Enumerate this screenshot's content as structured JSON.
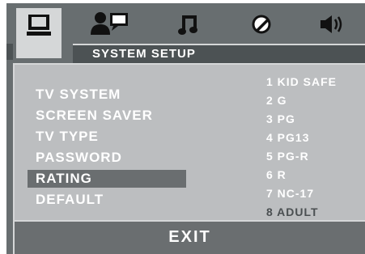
{
  "tabs": [
    {
      "icon": "monitor-icon",
      "active": true
    },
    {
      "icon": "user-speech-icon",
      "active": false
    },
    {
      "icon": "music-note-icon",
      "active": false
    },
    {
      "icon": "circle-slash-icon",
      "active": false
    },
    {
      "icon": "speaker-icon",
      "active": false
    }
  ],
  "title": "SYSTEM SETUP",
  "menu": {
    "items": [
      "TV SYSTEM",
      "SCREEN SAVER",
      "TV TYPE",
      "PASSWORD",
      "RATING",
      "DEFAULT"
    ],
    "selected_index": 4
  },
  "rating_options": {
    "items": [
      "1 KID SAFE",
      "2 G",
      "3 PG",
      "4 PG13",
      "5 PG-R",
      "6 R",
      "7 NC-17",
      "8 ADULT"
    ],
    "current_index": 7
  },
  "footer": {
    "exit_label": "EXIT"
  },
  "colors": {
    "background": "#686e70",
    "panel": "#bcbec0",
    "highlight": "#6a6e70",
    "text": "#ffffff"
  }
}
